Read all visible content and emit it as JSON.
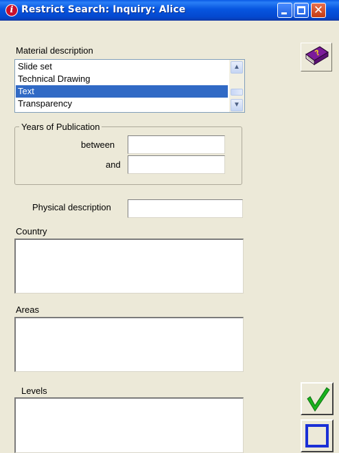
{
  "window": {
    "title": "Restrict Search: Inquiry: Alice",
    "title_icon": "info-icon",
    "controls": [
      "minimize-icon",
      "maximize-icon",
      "close-icon"
    ],
    "close_glyph": "✕"
  },
  "material": {
    "label": "Material description",
    "items": [
      {
        "label": "Slide set",
        "selected": false
      },
      {
        "label": "Technical Drawing",
        "selected": false
      },
      {
        "label": "Text",
        "selected": true
      },
      {
        "label": "Transparency",
        "selected": false
      }
    ],
    "scroll_up_glyph": "▲",
    "scroll_down_glyph": "▼"
  },
  "years": {
    "legend": "Years of Publication",
    "between_label": "between",
    "between_value": "",
    "and_label": "and",
    "and_value": ""
  },
  "physical": {
    "label": "Physical description",
    "value": ""
  },
  "country": {
    "label": "Country",
    "value": ""
  },
  "areas": {
    "label": "Areas",
    "value": ""
  },
  "levels": {
    "label": "Levels",
    "value": ""
  },
  "buttons": {
    "help_icon": "help-book-icon",
    "ok_icon": "checkmark-icon",
    "cancel_icon": "square-icon",
    "ok_glyph": "✓"
  },
  "colors": {
    "titlebar": "#0756e0",
    "selection": "#316ac5",
    "window_bg": "#ece9d8",
    "ok_check": "#1aa21a",
    "square_border": "#1a2fd6"
  }
}
